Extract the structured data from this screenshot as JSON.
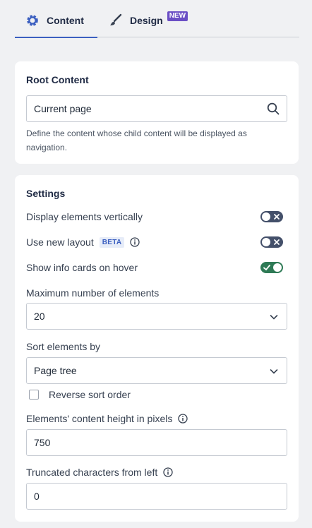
{
  "tabs": [
    {
      "label": "Content",
      "icon": "gear-icon",
      "active": true
    },
    {
      "label": "Design",
      "icon": "brush-icon",
      "badge": "NEW"
    }
  ],
  "root_content": {
    "title": "Root Content",
    "value": "Current page",
    "help": "Define the content whose child content will be displayed as navigation."
  },
  "settings": {
    "title": "Settings",
    "toggles": [
      {
        "label": "Display elements vertically",
        "state": "off"
      },
      {
        "label": "Use new layout",
        "badge": "BETA",
        "state": "off"
      },
      {
        "label": "Show info cards on hover",
        "state": "on"
      }
    ],
    "max_elements": {
      "label": "Maximum number of elements",
      "value": "20"
    },
    "sort": {
      "label": "Sort elements by",
      "value": "Page tree",
      "reverse_label": "Reverse sort order"
    },
    "content_height": {
      "label": "Elements' content height in pixels",
      "value": "750"
    },
    "truncated": {
      "label": "Truncated characters from left",
      "value": "0"
    }
  },
  "colors": {
    "accent": "#3b5fc0",
    "toggle_on": "#2e7a55",
    "toggle_off": "#44506a",
    "badge_new": "#6b4fc5"
  }
}
